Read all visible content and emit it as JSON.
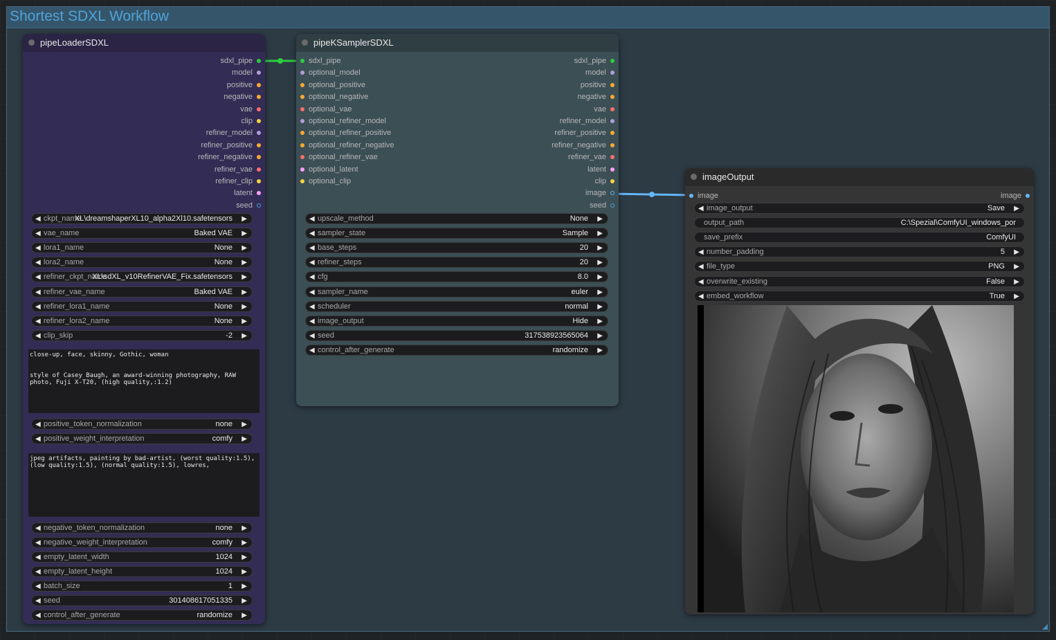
{
  "group": {
    "title": "Shortest SDXL Workflow"
  },
  "colors": {
    "clip": "#f6d33f",
    "model": "#b39ddb",
    "conditioning": "#ffa931",
    "vae": "#ff6e6e",
    "latent": "#ff9cf9",
    "int": "#4aa3df",
    "pipe": "#2ecc40",
    "image": "#64b5f6"
  },
  "loader": {
    "title": "pipeLoaderSDXL",
    "outputs": [
      "sdxl_pipe",
      "model",
      "positive",
      "negative",
      "vae",
      "clip",
      "refiner_model",
      "refiner_positive",
      "refiner_negative",
      "refiner_vae",
      "refiner_clip",
      "latent",
      "seed"
    ],
    "widgets": [
      {
        "label": "ckpt_name",
        "value": "XL\\dreamshaperXL10_alpha2Xl10.safetensors"
      },
      {
        "label": "vae_name",
        "value": "Baked VAE"
      },
      {
        "label": "lora1_name",
        "value": "None"
      },
      {
        "label": "lora2_name",
        "value": "None"
      },
      {
        "label": "refiner_ckpt_name",
        "value": "XL\\sdXL_v10RefinerVAE_Fix.safetensors"
      },
      {
        "label": "refiner_vae_name",
        "value": "Baked VAE"
      },
      {
        "label": "refiner_lora1_name",
        "value": "None"
      },
      {
        "label": "refiner_lora2_name",
        "value": "None"
      },
      {
        "label": "clip_skip",
        "value": "-2"
      }
    ],
    "positive_prompt": "close-up, face, skinny, Gothic, woman\n\n\nstyle of Casey Baugh, an award-winning photography, RAW photo, Fuji X-T20, (high quality,:1.2)",
    "widgets2": [
      {
        "label": "positive_token_normalization",
        "value": "none"
      },
      {
        "label": "positive_weight_interpretation",
        "value": "comfy"
      }
    ],
    "negative_prompt": "jpeg artifacts, painting by bad-artist, (worst quality:1.5), (low quality:1.5), (normal quality:1.5), lowres,",
    "widgets3": [
      {
        "label": "negative_token_normalization",
        "value": "none"
      },
      {
        "label": "negative_weight_interpretation",
        "value": "comfy"
      },
      {
        "label": "empty_latent_width",
        "value": "1024"
      },
      {
        "label": "empty_latent_height",
        "value": "1024"
      },
      {
        "label": "batch_size",
        "value": "1"
      },
      {
        "label": "seed",
        "value": "301408617051335"
      },
      {
        "label": "control_after_generate",
        "value": "randomize"
      }
    ]
  },
  "sampler": {
    "title": "pipeKSamplerSDXL",
    "inputs": [
      "sdxl_pipe",
      "optional_model",
      "optional_positive",
      "optional_negative",
      "optional_vae",
      "optional_refiner_model",
      "optional_refiner_positive",
      "optional_refiner_negative",
      "optional_refiner_vae",
      "optional_latent",
      "optional_clip"
    ],
    "outputs": [
      "sdxl_pipe",
      "model",
      "positive",
      "negative",
      "vae",
      "refiner_model",
      "refiner_positive",
      "refiner_negative",
      "refiner_vae",
      "latent",
      "clip",
      "image",
      "seed"
    ],
    "widgets": [
      {
        "label": "upscale_method",
        "value": "None"
      },
      {
        "label": "sampler_state",
        "value": "Sample"
      },
      {
        "label": "base_steps",
        "value": "20"
      },
      {
        "label": "refiner_steps",
        "value": "20"
      },
      {
        "label": "cfg",
        "value": "8.0"
      },
      {
        "label": "sampler_name",
        "value": "euler"
      },
      {
        "label": "scheduler",
        "value": "normal"
      },
      {
        "label": "image_output",
        "value": "Hide"
      },
      {
        "label": "seed",
        "value": "317538923565064"
      },
      {
        "label": "control_after_generate",
        "value": "randomize"
      }
    ]
  },
  "output": {
    "title": "imageOutput",
    "input": "image",
    "outputLabel": "image",
    "widgets": [
      {
        "label": "image_output",
        "value": "Save",
        "type": "combo"
      },
      {
        "label": "output_path",
        "value": "C:\\Spezial\\ComfyUI_windows_por",
        "type": "text"
      },
      {
        "label": "save_prefix",
        "value": "ComfyUI",
        "type": "text"
      },
      {
        "label": "number_padding",
        "value": "5",
        "type": "combo"
      },
      {
        "label": "file_type",
        "value": "PNG",
        "type": "combo"
      },
      {
        "label": "overwrite_existing",
        "value": "False",
        "type": "combo"
      },
      {
        "label": "embed_workflow",
        "value": "True",
        "type": "combo"
      }
    ]
  }
}
